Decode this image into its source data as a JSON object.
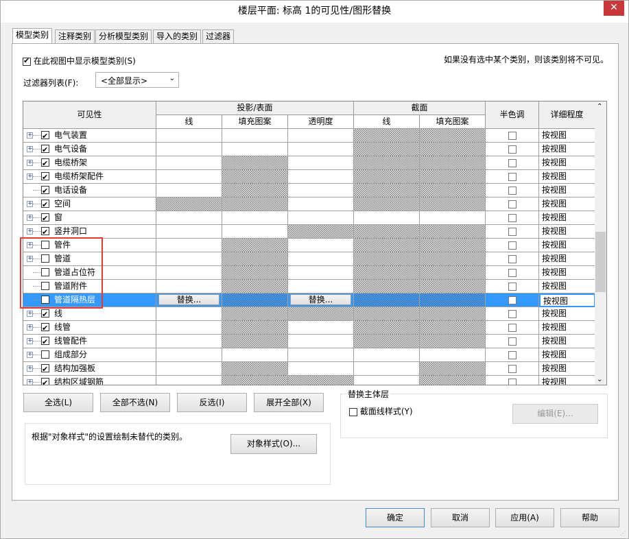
{
  "window": {
    "title": "楼层平面: 标高 1的可见性/图形替换",
    "close": "✕"
  },
  "tabs": [
    "模型类别",
    "注释类别",
    "分析模型类别",
    "导入的类别",
    "过滤器"
  ],
  "show_model": {
    "label": "在此视图中显示模型类别(S)",
    "checked": true
  },
  "hint": "如果没有选中某个类别，则该类别将不可见。",
  "filter": {
    "label": "过滤器列表(F):",
    "value": "<全部显示>"
  },
  "table": {
    "headers": {
      "visibility": "可见性",
      "projection": "投影/表面",
      "cut": "截面",
      "halftone": "半色调",
      "detail": "详细程度",
      "line": "线",
      "fill": "填充图案",
      "transparency": "透明度",
      "cut_line": "线",
      "cut_fill": "填充图案"
    },
    "override_label": "替换...",
    "rows": [
      {
        "name": "电气装置",
        "checked": true,
        "expand": true,
        "hatch": [
          0,
          0,
          0,
          1,
          1
        ],
        "detail": "按视图"
      },
      {
        "name": "电气设备",
        "checked": true,
        "expand": true,
        "hatch": [
          0,
          0,
          0,
          1,
          1
        ],
        "detail": "按视图"
      },
      {
        "name": "电缆桥架",
        "checked": true,
        "expand": true,
        "hatch": [
          0,
          1,
          0,
          1,
          1
        ],
        "detail": "按视图"
      },
      {
        "name": "电缆桥架配件",
        "checked": true,
        "expand": true,
        "hatch": [
          0,
          1,
          0,
          1,
          1
        ],
        "detail": "按视图"
      },
      {
        "name": "电话设备",
        "checked": true,
        "expand": false,
        "hatch": [
          0,
          1,
          0,
          1,
          1
        ],
        "detail": "按视图"
      },
      {
        "name": "空间",
        "checked": true,
        "expand": true,
        "hatch": [
          1,
          1,
          0,
          1,
          1
        ],
        "detail": "按视图"
      },
      {
        "name": "窗",
        "checked": true,
        "expand": true,
        "hatch": [
          0,
          0,
          0,
          0,
          0
        ],
        "detail": "按视图"
      },
      {
        "name": "竖井洞口",
        "checked": true,
        "expand": true,
        "hatch": [
          0,
          0,
          1,
          1,
          1
        ],
        "detail": "按视图"
      },
      {
        "name": "管件",
        "checked": false,
        "expand": true,
        "hatch": [
          0,
          1,
          0,
          1,
          1
        ],
        "detail": "按视图"
      },
      {
        "name": "管道",
        "checked": false,
        "expand": true,
        "hatch": [
          0,
          1,
          0,
          1,
          1
        ],
        "detail": "按视图"
      },
      {
        "name": "管道占位符",
        "checked": false,
        "expand": false,
        "hatch": [
          0,
          1,
          0,
          1,
          1
        ],
        "detail": "按视图"
      },
      {
        "name": "管道附件",
        "checked": false,
        "expand": false,
        "hatch": [
          0,
          1,
          0,
          1,
          1
        ],
        "detail": "按视图"
      },
      {
        "name": "管道隔热层",
        "checked": false,
        "expand": false,
        "selected": true,
        "hatch": [
          0,
          1,
          0,
          1,
          1
        ],
        "detail": "按视图"
      },
      {
        "name": "线",
        "checked": true,
        "expand": true,
        "hatch": [
          0,
          1,
          1,
          1,
          1
        ],
        "detail": "按视图"
      },
      {
        "name": "线管",
        "checked": true,
        "expand": true,
        "hatch": [
          0,
          1,
          0,
          1,
          1
        ],
        "detail": "按视图"
      },
      {
        "name": "线管配件",
        "checked": true,
        "expand": true,
        "hatch": [
          0,
          1,
          0,
          1,
          1
        ],
        "detail": "按视图"
      },
      {
        "name": "组成部分",
        "checked": false,
        "expand": true,
        "hatch": [
          0,
          0,
          0,
          0,
          0
        ],
        "detail": "按视图"
      },
      {
        "name": "结构加强板",
        "checked": true,
        "expand": true,
        "hatch": [
          0,
          1,
          0,
          0,
          1
        ],
        "detail": "按视图"
      },
      {
        "name": "结构区域钢筋",
        "checked": true,
        "expand": true,
        "hatch": [
          0,
          1,
          1,
          0,
          1
        ],
        "detail": "按视图"
      }
    ]
  },
  "buttons": {
    "select_all": "全选(L)",
    "select_none": "全部不选(N)",
    "invert": "反选(I)",
    "expand_all": "展开全部(X)",
    "object_styles": "对象样式(O)...",
    "edit": "编辑(E)...",
    "ok": "确定",
    "cancel": "取消",
    "apply": "应用(A)",
    "help": "帮助"
  },
  "note": "根据\"对象样式\"的设置绘制未替代的类别。",
  "host": {
    "title": "替换主体层",
    "cut_line_label": "截面线样式(Y)"
  },
  "colors": {
    "selection": "#3399ff",
    "highlight": "#e53935"
  }
}
